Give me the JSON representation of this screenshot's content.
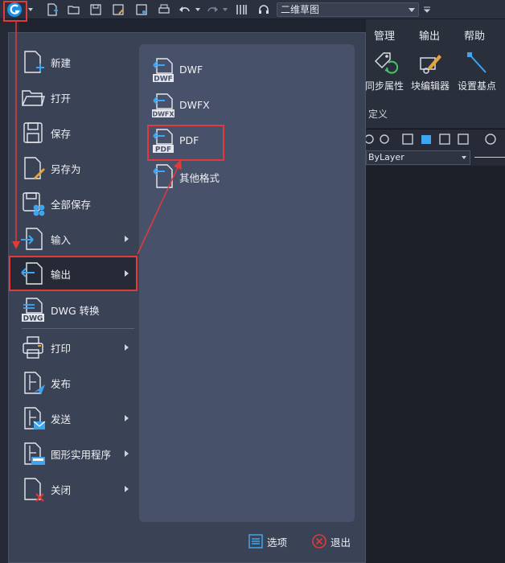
{
  "quick_access": {
    "workspace": "二维草图"
  },
  "ribbon": {
    "tabs": [
      "管理",
      "输出",
      "帮助"
    ],
    "tools": [
      "同步属性",
      "块编辑器",
      "设置基点"
    ],
    "group_label": "定义"
  },
  "properties": {
    "layer_value": "ByLayer"
  },
  "app_menu": {
    "items": [
      {
        "label": "新建",
        "icon": "new-file-icon",
        "has_submenu": false
      },
      {
        "label": "打开",
        "icon": "open-folder-icon",
        "has_submenu": false
      },
      {
        "label": "保存",
        "icon": "save-icon",
        "has_submenu": false
      },
      {
        "label": "另存为",
        "icon": "save-as-icon",
        "has_submenu": false
      },
      {
        "label": "全部保存",
        "icon": "save-all-icon",
        "has_submenu": false
      },
      {
        "label": "输入",
        "icon": "import-icon",
        "has_submenu": true
      },
      {
        "label": "输出",
        "icon": "export-icon",
        "has_submenu": true,
        "active": true
      },
      {
        "label": "DWG 转换",
        "icon": "dwg-convert-icon",
        "has_submenu": false
      },
      {
        "label": "打印",
        "icon": "print-icon",
        "has_submenu": true
      },
      {
        "label": "发布",
        "icon": "publish-icon",
        "has_submenu": false
      },
      {
        "label": "发送",
        "icon": "send-icon",
        "has_submenu": true
      },
      {
        "label": "图形实用程序",
        "icon": "drawing-utilities-icon",
        "has_submenu": true
      },
      {
        "label": "关闭",
        "icon": "close-file-icon",
        "has_submenu": true
      }
    ],
    "export_submenu": [
      {
        "label": "DWF",
        "badge": "DWF"
      },
      {
        "label": "DWFX",
        "badge": "DWFX"
      },
      {
        "label": "PDF",
        "badge": "PDF",
        "highlighted": true
      },
      {
        "label": "其他格式",
        "badge": ""
      }
    ],
    "options_label": "选项",
    "exit_label": "退出"
  },
  "colors": {
    "accent_blue": "#3ea6f0",
    "highlight_red": "#e03a3a",
    "menu_bg": "#3a4255",
    "submenu_bg": "#47526a"
  }
}
